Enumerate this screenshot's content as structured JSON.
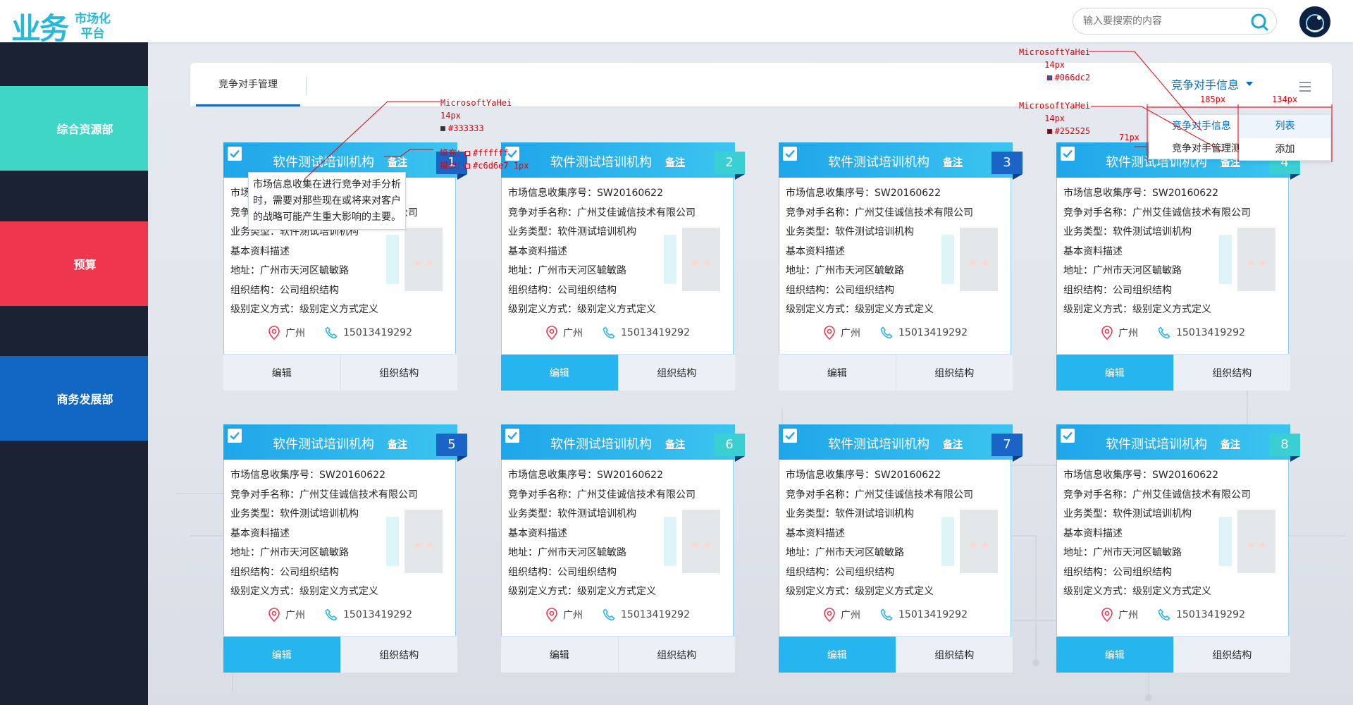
{
  "header": {
    "logo_mark": "业务",
    "logo_line1": "市场化",
    "logo_line2": "平台",
    "search_placeholder": "输入要搜索的内容"
  },
  "sidebar": {
    "items": [
      {
        "label": "综合资源部",
        "color": "#3fd6c6",
        "fold": "#1f9f94"
      },
      {
        "label": "预算",
        "color": "#f0364f",
        "fold": "#a61d31"
      },
      {
        "label": "商务发展部",
        "color": "#1267c5",
        "fold": "#0a3f7e"
      }
    ]
  },
  "tabbar": {
    "tab": "竞争对手管理",
    "dropdown_label": "竞争对手信息"
  },
  "dropdown_left": {
    "items": [
      "竞争对手信息",
      "竞争对手管理测"
    ]
  },
  "dropdown_right": {
    "items": [
      "列表",
      "添加"
    ]
  },
  "card_template": {
    "title": "软件测试培训机构",
    "note": "备注",
    "lines": [
      "市场信息收集序号：SW20160622",
      "竞争对手名称：广州艾佳诚信技术有限公司",
      "业务类型：软件测试培训机构",
      "基本资料描述",
      "地址：广州市天河区毓敏路",
      "组织结构：公司组织结构",
      "级别定义方式：级别定义方式定义"
    ],
    "city": "广州",
    "phone": "15013419292",
    "btn_edit": "编辑",
    "btn_org": "组织结构"
  },
  "cards": [
    {
      "num": "1",
      "num_color": "#1a63c7",
      "edit_primary": false
    },
    {
      "num": "2",
      "num_color": "#3ad0d3",
      "edit_primary": true
    },
    {
      "num": "3",
      "num_color": "#1a63c7",
      "edit_primary": false
    },
    {
      "num": "4",
      "num_color": "#3ad0d3",
      "edit_primary": true
    },
    {
      "num": "5",
      "num_color": "#1a63c7",
      "edit_primary": true
    },
    {
      "num": "6",
      "num_color": "#3ad0d3",
      "edit_primary": false
    },
    {
      "num": "7",
      "num_color": "#1a63c7",
      "edit_primary": true
    },
    {
      "num": "8",
      "num_color": "#3ad0d3",
      "edit_primary": true
    }
  ],
  "tooltip": {
    "text": "市场信息收集在进行竞争对手分析时，需要对那些现在或将来对客户的战略可能产生重大影响的主要。"
  },
  "annotations": {
    "a1_font": "MicrosoftYaHei",
    "a1_size": "14px",
    "a1_color": "#333333",
    "a2_fill": "填充：",
    "a2_fill_val": "#ffffff",
    "a2_stroke": "描边：",
    "a2_stroke_val": "#c6d6e7 1px",
    "a3_font": "MicrosoftYaHei",
    "a3_size": "14px",
    "a3_color": "#066dc2",
    "a4_font": "MicrosoftYaHei",
    "a4_size": "14px",
    "a4_color": "#252525",
    "dim_185": "185px",
    "dim_134": "134px",
    "dim_71": "71px"
  }
}
